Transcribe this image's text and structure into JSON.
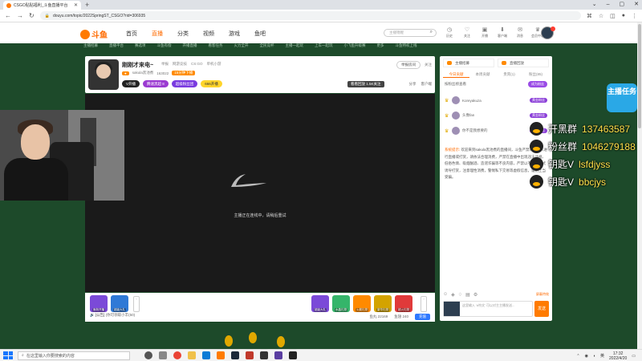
{
  "browser": {
    "tab_title": "CSGO贴贴福利_斗鱼直播平台",
    "url": "douyu.com/topic/2022SpringST_CSGO?rid=306935"
  },
  "site": {
    "logo_text": "斗鱼",
    "nav": [
      "首页",
      "直播",
      "分类",
      "视频",
      "游戏",
      "鱼吧"
    ],
    "active_nav": "直播",
    "search_placeholder": "主播锦鲤",
    "user_icons": [
      "历史",
      "关注",
      "开播",
      "客户端",
      "消息",
      "会员中心"
    ],
    "subnav": [
      "主播招募",
      "直播平台",
      "赛选项",
      "斗鱼有偿",
      "开播直播",
      "看客任务",
      "火力全开",
      "全民竞杯",
      "主播一起玩",
      "上车一起玩",
      "小飞鱼升级赛",
      "更多",
      "斗鱼特权上线"
    ]
  },
  "room": {
    "title": "刚刚才来电~",
    "meta": [
      "举报",
      "网游竞技",
      "CS:GO",
      "单机小游"
    ],
    "streamer": "sakula黑池煮",
    "fans": "163022",
    "live_badge": "15分钟下播",
    "level_pills": [
      "V开播",
      "腾速黑超 8",
      "超级粉丝团",
      "666开播"
    ],
    "report_btn": "举报房间",
    "fav_count": "关注",
    "follow_tag": "看看回放 1.5K关注",
    "share": "分享",
    "client_btn": "客户端"
  },
  "video": {
    "message": "主播正在连线中，请稍后重试"
  },
  "below": {
    "gifts_left": [
      "鱼粉开播",
      "超级大礼"
    ],
    "gifts_right": [
      "超级大礼",
      "水晶礼物",
      "火箭礼物",
      "豪华礼物",
      "超火礼物",
      "旺旺礼物"
    ],
    "notice_label": "[公告]",
    "notice_text": "(你可领取小丰(50)",
    "stats": [
      "鱼丸 22169",
      "鱼翅 240"
    ],
    "btn_text": "充值"
  },
  "chat": {
    "top_tabs": [
      "主播招募",
      "直播回放"
    ],
    "tabs": [
      "今日贡献",
      "本周贡献",
      "贵宾(1)",
      "粉丝(85)"
    ],
    "active_tab": "今日贡献",
    "rank_title": "按粉丝榜查看",
    "rank_btn": "成为粉丝",
    "ranks": [
      {
        "name": "Koreyakuza",
        "level": "黄金粉丝"
      },
      {
        "name": "头像fan",
        "level": "黄金粉丝"
      },
      {
        "name": "你不是我想要的",
        "level": "黄金粉丝"
      }
    ],
    "system_label": "系统提示:",
    "system_text": "欢迎来到sakula黑池煮的直播间，斗鱼严禁未成年人进行直播或打赏，请依法合理消费，严禁在直播中出现违法违规、低俗色情、吸烟酗酒、造谣诈骗等不良内容，严禁以不正当方式诱导打赏，注意理性消费，警惕私下交易等虚假信息，谨防上当受骗。",
    "input_placeholder": "这里输入 '#符文' 可以对主主播发送...",
    "send_btn": "发送",
    "tools_link": "屏蔽特效"
  },
  "overlay": {
    "badge": "主播任务",
    "lines": [
      {
        "k": "开黑群",
        "v": "137463587"
      },
      {
        "k": "粉丝群",
        "v": "1046279188"
      },
      {
        "k": "钥匙V",
        "v": "lsfdjyss"
      },
      {
        "k": "钥匙V",
        "v": "bbcjys"
      }
    ]
  },
  "taskbar": {
    "search_placeholder": "在这里输入你要搜索的内容",
    "time": "17:32",
    "date": "2022/4/20",
    "lang": "英"
  }
}
